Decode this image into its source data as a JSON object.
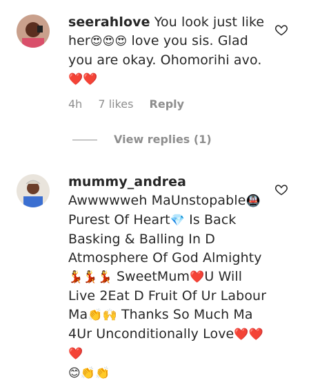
{
  "comments": [
    {
      "username": "seerahlove",
      "body_parts": {
        "a": "You look just like her",
        "e1": "😍😍😍",
        "b": " love you sis. Glad you are okay. Ohomorihi avo.",
        "e2": "❤️❤️"
      },
      "time": "4h",
      "likes": "7 likes",
      "reply_label": "Reply",
      "view_replies": "View replies (1)"
    },
    {
      "username": "mummy_andrea",
      "body_parts": {
        "a": "Awwwwweh MaUnstopable",
        "e1": "🚇",
        "b": " Purest Of Heart",
        "e2": "💎",
        "c": " Is Back Basking & Balling In D Atmosphere Of God Almighty",
        "e3": "💃💃💃",
        "d": "SweetMum",
        "e4": "❤️",
        "f": "U Will Live 2Eat D Fruit Of Ur Labour Ma",
        "e5": "👏🙌",
        "g": "Thanks So Much Ma 4Ur Unconditionally Love",
        "e6": "❤️❤️❤️",
        "e7": "😊👏👏"
      }
    }
  ]
}
